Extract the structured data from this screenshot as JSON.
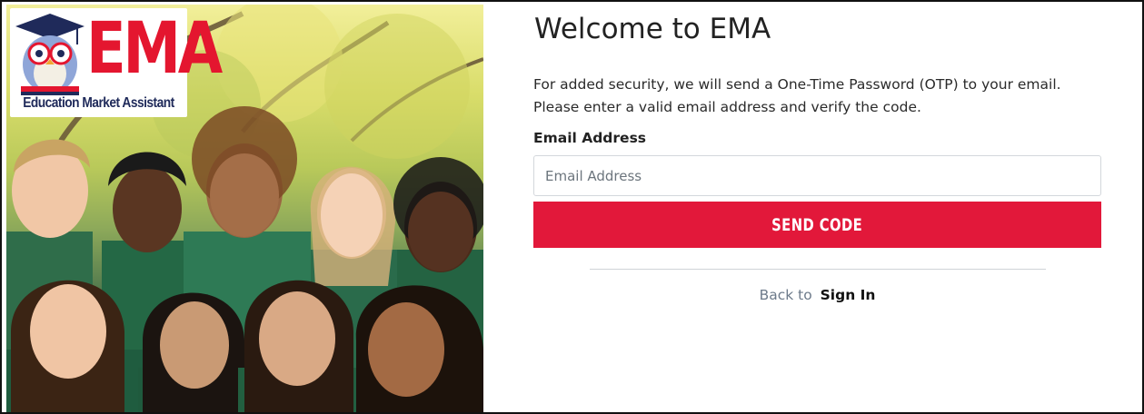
{
  "logo": {
    "mark": "EMA",
    "tagline": "Education Market Assistant"
  },
  "main": {
    "title": "Welcome to EMA",
    "description_line1": "For added security, we will send a One-Time Password (OTP) to your email.",
    "description_line2": "Please enter a valid email address and verify the code.",
    "email_label": "Email Address",
    "email_placeholder": "Email Address",
    "email_value": "",
    "send_button_label": "SEND CODE",
    "back_text": "Back to",
    "signin_link": "Sign In"
  },
  "colors": {
    "brand_red": "#e2183a",
    "logo_red": "#e4162f",
    "logo_navy": "#1f2a5a"
  }
}
